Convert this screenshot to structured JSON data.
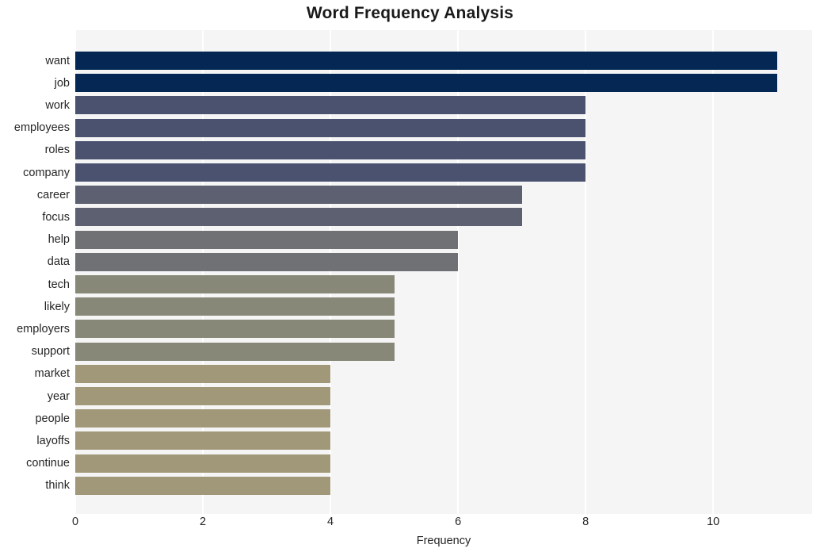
{
  "chart_data": {
    "type": "bar",
    "orientation": "horizontal",
    "title": "Word Frequency Analysis",
    "xlabel": "Frequency",
    "ylabel": "",
    "categories": [
      "want",
      "job",
      "work",
      "employees",
      "roles",
      "company",
      "career",
      "focus",
      "help",
      "data",
      "tech",
      "likely",
      "employers",
      "support",
      "market",
      "year",
      "people",
      "layoffs",
      "continue",
      "think"
    ],
    "values": [
      11,
      11,
      8,
      8,
      8,
      8,
      7,
      7,
      6,
      6,
      5,
      5,
      5,
      5,
      4,
      4,
      4,
      4,
      4,
      4
    ],
    "bar_colors": [
      "#042754",
      "#042754",
      "#4a5270",
      "#4a5270",
      "#4a5270",
      "#4a5270",
      "#5c6070",
      "#5c6070",
      "#6f7175",
      "#6f7175",
      "#888878",
      "#888878",
      "#888878",
      "#888878",
      "#a09878",
      "#a09878",
      "#a09878",
      "#a09878",
      "#a09878",
      "#a09878"
    ],
    "xlim": [
      0,
      11.55
    ],
    "xticks": [
      0,
      2,
      4,
      6,
      8,
      10
    ],
    "xtick_labels": [
      "0",
      "2",
      "4",
      "6",
      "8",
      "10"
    ],
    "grid": true,
    "grid_axis": "x",
    "legend": null,
    "plot_background": "#f5f5f6",
    "figure_background": "#ffffff",
    "gridline_color": "#ffffff",
    "title_color": "#1a1a1a",
    "tick_label_color": "#262626"
  }
}
